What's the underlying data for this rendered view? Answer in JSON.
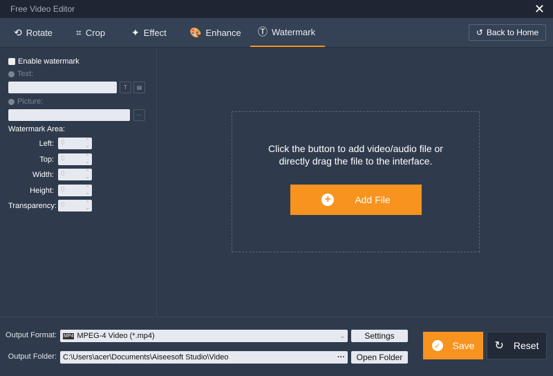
{
  "window": {
    "title": "Free Video Editor"
  },
  "tabs": [
    {
      "label": "Rotate",
      "icon": "rotate-icon"
    },
    {
      "label": "Crop",
      "icon": "crop-icon"
    },
    {
      "label": "Effect",
      "icon": "effect-icon"
    },
    {
      "label": "Enhance",
      "icon": "palette-icon"
    },
    {
      "label": "Watermark",
      "icon": "watermark-icon"
    }
  ],
  "active_tab": "Watermark",
  "back_home": "Back to Home",
  "panel": {
    "enable": "Enable watermark",
    "text": "Text:",
    "picture": "Picture:",
    "area": "Watermark Area:",
    "more": "···",
    "fields": [
      {
        "label": "Left:",
        "value": "0"
      },
      {
        "label": "Top:",
        "value": "0"
      },
      {
        "label": "Width:",
        "value": "0"
      },
      {
        "label": "Height:",
        "value": "0"
      },
      {
        "label": "Transparency:",
        "value": "0"
      }
    ]
  },
  "drop": {
    "line1": "Click the button to add video/audio file or",
    "line2": "directly drag the file to the interface.",
    "add": "Add File"
  },
  "output": {
    "format_label": "Output Format:",
    "format": "MPEG-4 Video (*.mp4)",
    "settings": "Settings",
    "folder_label": "Output Folder:",
    "folder": "C:\\Users\\acer\\Documents\\Aiseesoft Studio\\Video",
    "dots": "···",
    "open": "Open Folder"
  },
  "save": "Save",
  "reset": "Reset",
  "colors": {
    "accent": "#f7931e"
  }
}
